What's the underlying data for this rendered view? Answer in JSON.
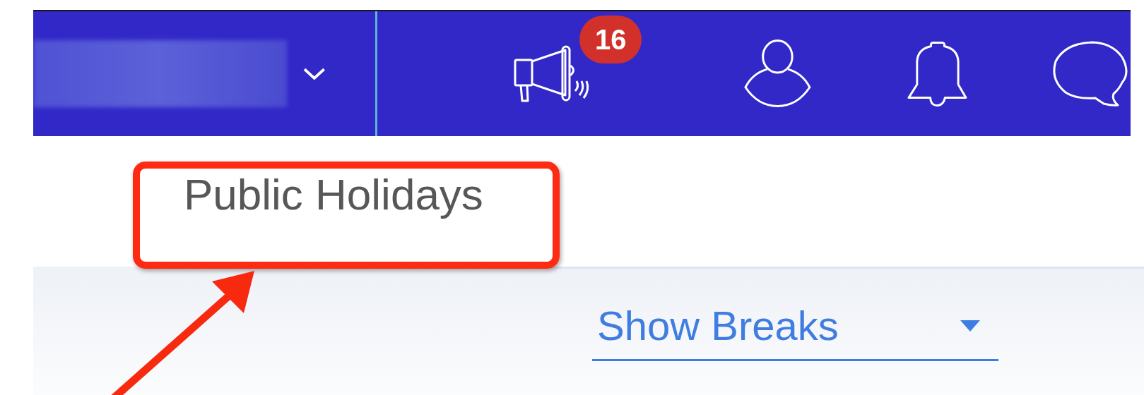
{
  "header": {
    "account_selector": {
      "kind": "blurred"
    },
    "announcements": {
      "badge": "16"
    }
  },
  "page_title": "Public Holidays",
  "toolbar": {
    "breaks_dropdown": {
      "label": "Show Breaks"
    }
  },
  "annotations": [
    {
      "kind": "highlight-box"
    },
    {
      "kind": "arrow"
    }
  ]
}
